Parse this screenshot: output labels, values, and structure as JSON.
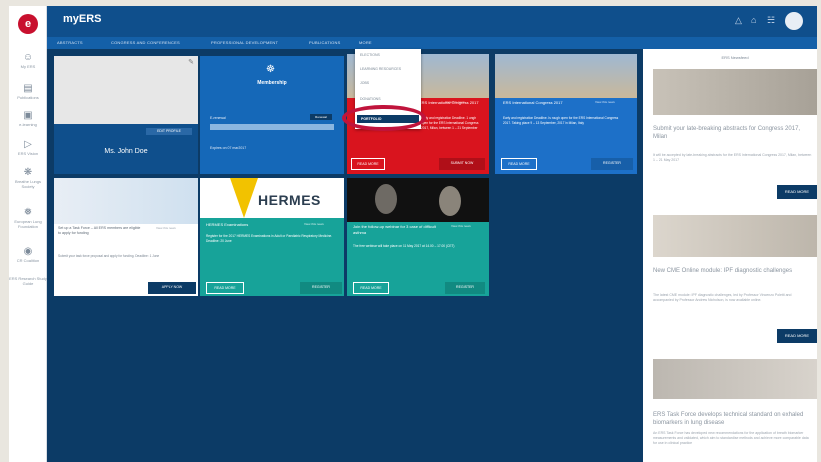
{
  "app": {
    "title": "myERS"
  },
  "rail": {
    "logo": "e",
    "items": [
      {
        "label": "My ERS"
      },
      {
        "label": "Publications"
      },
      {
        "label": "e-learning"
      },
      {
        "label": "ERS Vision"
      },
      {
        "label": "Breathe Lungs Society"
      },
      {
        "label": "European Lung Foundation"
      },
      {
        "label": "CR Coalition"
      },
      {
        "label": "ERS Research Study Guide"
      }
    ]
  },
  "nav": {
    "items": [
      "ABSTRACTS",
      "CONGRESS AND CONFERENCES",
      "PROFESSIONAL DEVELOPMENT",
      "PUBLICATIONS",
      "MORE"
    ]
  },
  "dropdown": {
    "items": [
      "ELECTIONS",
      "LEARNING RESOURCES",
      "JOBS",
      "DONATIONS"
    ],
    "selected": "PORTFOLIO"
  },
  "profile": {
    "name": "Ms. John Doe",
    "edit_label": "EDIT PROFILE"
  },
  "membership": {
    "title": "Membership",
    "status": "E-renewal",
    "badge": "Renewal",
    "expires": "Expires on 07 mar2017"
  },
  "cards": [
    {
      "title": "ERS International Congress 2017",
      "link": "View this news",
      "text": "Early and registration Deadline. 1 ungh open for the ERS International Congress 2017, Milan, between 1 – 21 September",
      "btn1": "READ MORE",
      "btn2": "SUBMIT NOW"
    },
    {
      "title": "ERS International Congress 2017",
      "link": "View this news",
      "text": "Early and registration Deadline. Is rough open for the ERS International Congress 2017. Taking place 9 – 13 September, 2017 in Milan, Italy",
      "btn1": "READ MORE",
      "btn2": "REGISTER"
    },
    {
      "title": "Set up a Task Force – All ERS members are eligible to apply for funding",
      "link": "View this news",
      "text": "Submit your task force proposal and apply for funding. Deadline: 1 June",
      "btn1": "APPLY NOW"
    },
    {
      "brand": "HERMES",
      "title": "HERMES Examinations",
      "link": "View this news",
      "text": "Register for the 2017 HERMES Examinations in Adult or Paediatric Respiratory Medicine. Deadline: 20 June",
      "btn1": "READ MORE",
      "btn2": "REGISTER"
    },
    {
      "title": "Join the follow-up webinar for 3 case of difficult asthma",
      "link": "View this news",
      "text": "The free webinar will take place on 11 May 2017 at 14.00 – 17.00 (CET)",
      "btn1": "READ MORE",
      "btn2": "REGISTER"
    }
  ],
  "sidebar": {
    "title": "ERS Newsfeed",
    "items": [
      {
        "title": "Submit your late-breaking abstracts for Congress 2017, Milan",
        "text": "It will be accepted by late-breaking abstracts for the ERS International Congress 2017, Milan, between 1 – 21 May 2017",
        "btn": "READ MORE"
      },
      {
        "title": "New CME Online module: IPF diagnostic challenges",
        "text": "The latest CME module: IPF diagnostic challenges, led by Professor Vincenzo Poletti and accompanied by Professor Andrew Nicholson, is now available online.",
        "btn": "READ MORE"
      },
      {
        "title": "ERS Task Force develops technical standard on exhaled biomarkers in lung disease",
        "text": "An ERS Task Force has developed new recommendations for the application of breath biomarker measurements and validated, which aim to standardise methods and achieve more comparable data for use in clinical practice"
      }
    ]
  }
}
